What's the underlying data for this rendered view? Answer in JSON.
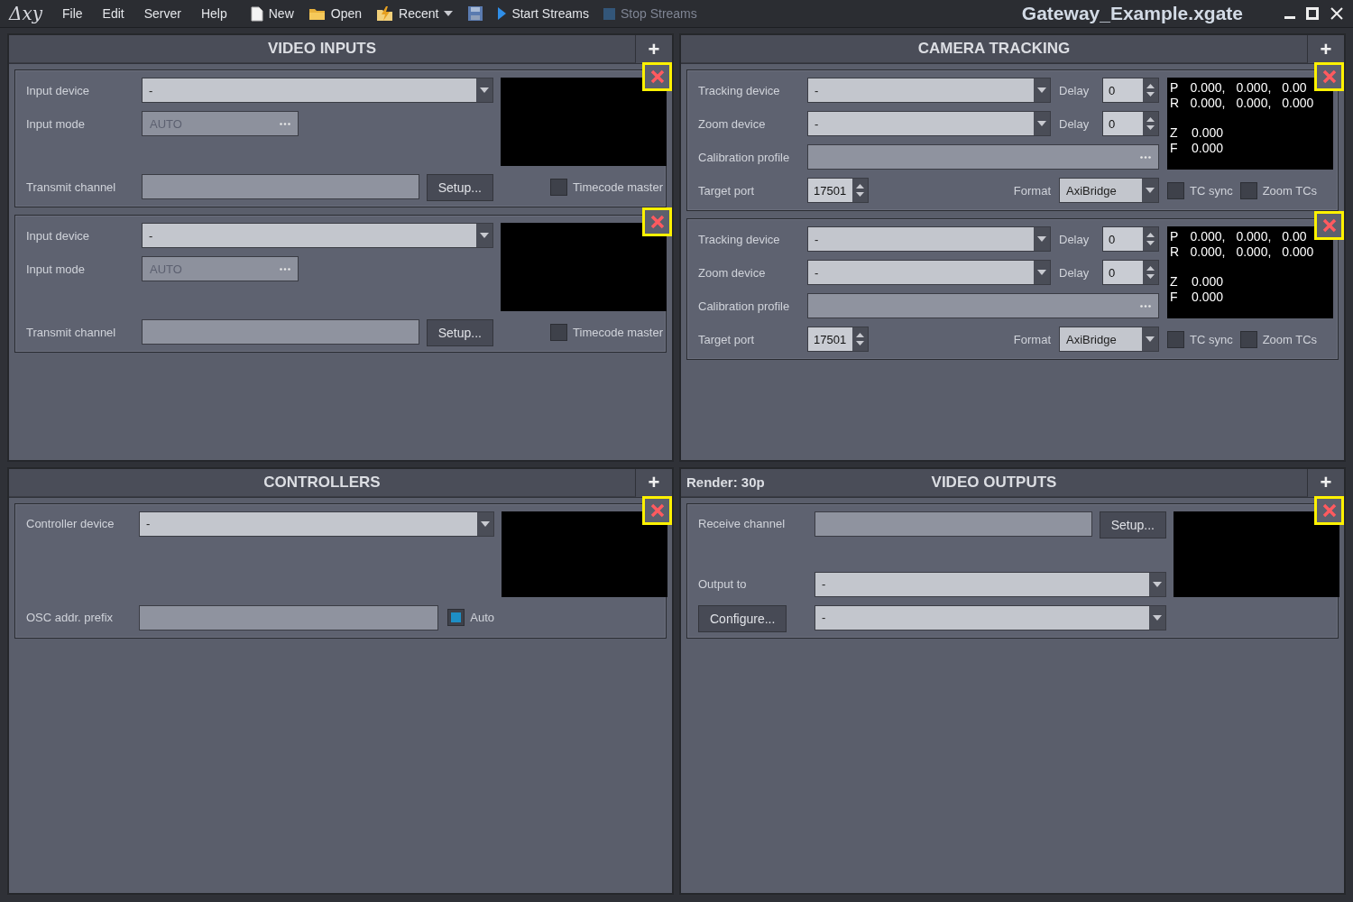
{
  "window": {
    "logo": "Δxy",
    "title": "Gateway_Example.xgate"
  },
  "menus": [
    {
      "label": "File"
    },
    {
      "label": "Edit"
    },
    {
      "label": "Server"
    },
    {
      "label": "Help"
    }
  ],
  "toolbar": [
    {
      "kind": "new",
      "label": "New",
      "disabled": false
    },
    {
      "kind": "open",
      "label": "Open",
      "disabled": false
    },
    {
      "kind": "recent",
      "label": "Recent",
      "disabled": false
    },
    {
      "kind": "save",
      "disabled": false
    },
    {
      "kind": "start",
      "label": "Start Streams",
      "disabled": false
    },
    {
      "kind": "stop",
      "label": "Stop Streams",
      "disabled": true
    }
  ],
  "panels": [
    {
      "kind": "video_inputs",
      "title": "VIDEO INPUTS",
      "add": "+",
      "cards": [
        {
          "input_device": {
            "label": "Input device",
            "value": "-"
          },
          "input_mode": {
            "label": "Input mode",
            "value": "AUTO",
            "disabled": true
          },
          "transmit": {
            "label": "Transmit channel",
            "button": "Setup..."
          },
          "timecode_master": {
            "label": "Timecode master",
            "checked": false
          }
        },
        {
          "input_device": {
            "label": "Input device",
            "value": "-"
          },
          "input_mode": {
            "label": "Input mode",
            "value": "AUTO",
            "disabled": true
          },
          "transmit": {
            "label": "Transmit channel",
            "button": "Setup..."
          },
          "timecode_master": {
            "label": "Timecode master",
            "checked": false
          }
        }
      ]
    },
    {
      "kind": "camera_tracking",
      "title": "CAMERA TRACKING",
      "add": "+",
      "cards": [
        {
          "tracking": {
            "label": "Tracking device",
            "value": "-",
            "delay_label": "Delay",
            "delay": "0"
          },
          "zoom": {
            "label": "Zoom device",
            "value": "-",
            "delay_label": "Delay",
            "delay": "0"
          },
          "calibration": {
            "label": "Calibration profile"
          },
          "port": {
            "label": "Target port",
            "value": "17501"
          },
          "format": {
            "label": "Format",
            "value": "AxiBridge"
          },
          "tc_sync": {
            "label": "TC sync",
            "checked": false
          },
          "zoom_tcs": {
            "label": "Zoom TCs",
            "checked": false
          },
          "readout": [
            {
              "axis": "P",
              "values": [
                "0.000,",
                "0.000,",
                "0.00"
              ]
            },
            {
              "axis": "R",
              "values": [
                "0.000,",
                "0.000,",
                "0.000"
              ]
            },
            {
              "axis": "Z",
              "values": [
                "0.000"
              ]
            },
            {
              "axis": "F",
              "values": [
                "0.000"
              ]
            }
          ]
        },
        {
          "tracking": {
            "label": "Tracking device",
            "value": "-",
            "delay_label": "Delay",
            "delay": "0"
          },
          "zoom": {
            "label": "Zoom device",
            "value": "-",
            "delay_label": "Delay",
            "delay": "0"
          },
          "calibration": {
            "label": "Calibration profile"
          },
          "port": {
            "label": "Target port",
            "value": "17501"
          },
          "format": {
            "label": "Format",
            "value": "AxiBridge"
          },
          "tc_sync": {
            "label": "TC sync",
            "checked": false
          },
          "zoom_tcs": {
            "label": "Zoom TCs",
            "checked": false
          },
          "readout": [
            {
              "axis": "P",
              "values": [
                "0.000,",
                "0.000,",
                "0.00"
              ]
            },
            {
              "axis": "R",
              "values": [
                "0.000,",
                "0.000,",
                "0.000"
              ]
            },
            {
              "axis": "Z",
              "values": [
                "0.000"
              ]
            },
            {
              "axis": "F",
              "values": [
                "0.000"
              ]
            }
          ]
        }
      ]
    },
    {
      "kind": "controllers",
      "title": "CONTROLLERS",
      "add": "+",
      "cards": [
        {
          "device": {
            "label": "Controller device",
            "value": "-"
          },
          "osc": {
            "label": "OSC addr. prefix"
          },
          "auto": {
            "label": "Auto",
            "checked": true
          }
        }
      ]
    },
    {
      "kind": "video_outputs",
      "title": "VIDEO OUTPUTS",
      "add": "+",
      "render": "Render: 30p",
      "cards": [
        {
          "receive": {
            "label": "Receive channel",
            "button": "Setup..."
          },
          "output": {
            "label": "Output to",
            "value": "-"
          },
          "configure": {
            "button": "Configure...",
            "value": "-"
          }
        }
      ]
    }
  ]
}
